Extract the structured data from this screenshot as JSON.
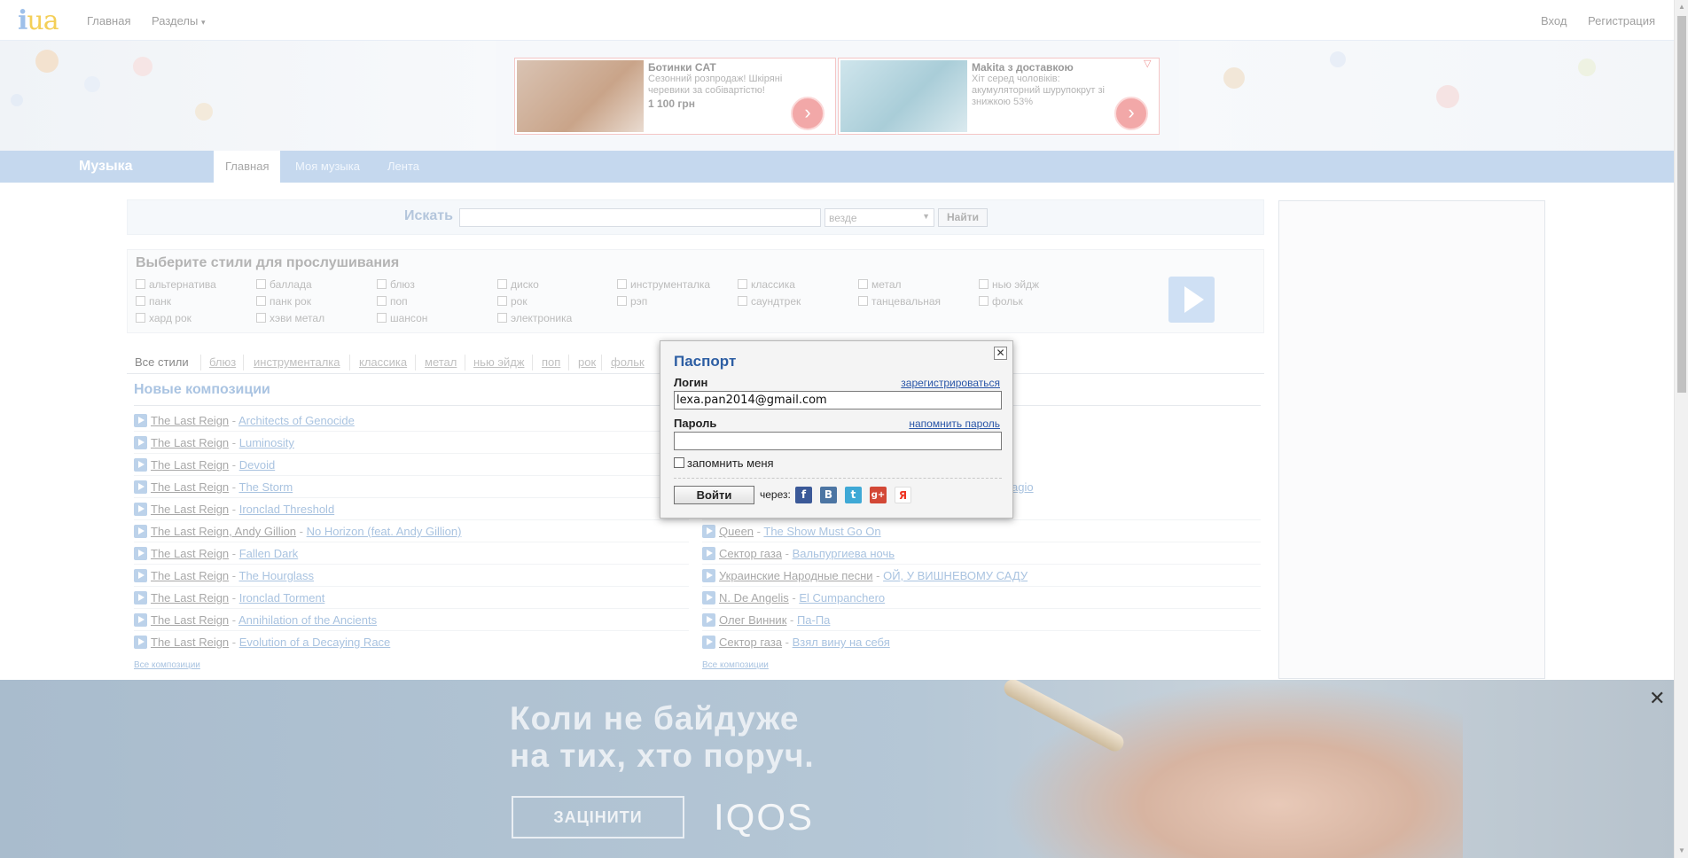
{
  "topbar": {
    "logo_i": "i",
    "logo_ua": "ua",
    "nav_home": "Главная",
    "nav_sections": "Разделы",
    "nav_sections_arrow": "▾",
    "login": "Вход",
    "register": "Регистрация"
  },
  "ads": [
    {
      "title": "Ботинки CAT",
      "text": "Сезонний розпродаж! Шкіряні черевики за собівартістю!",
      "price": "1 100 грн"
    },
    {
      "title": "Makita з доставкою",
      "text": "Хіт серед чоловіків: акумуляторний шурупокрут зі знижкою 53%",
      "price": ""
    }
  ],
  "music": {
    "title": "Музыка",
    "tabs": [
      "Главная",
      "Моя музыка",
      "Лента"
    ]
  },
  "search": {
    "label": "Искать",
    "value": "",
    "scope": "везде",
    "button": "Найти"
  },
  "styles": {
    "heading": "Выберите стили для прослушивания",
    "items": [
      "альтернатива",
      "баллада",
      "блюз",
      "диско",
      "инструменталка",
      "классика",
      "метал",
      "нью эйдж",
      "панк",
      "панк рок",
      "поп",
      "рок",
      "рэп",
      "саундтрек",
      "танцевальная",
      "фольк",
      "хард рок",
      "хэви метал",
      "шансон",
      "электроника"
    ]
  },
  "filters": [
    "Все стили",
    "блюз",
    "инструменталка",
    "классика",
    "метал",
    "нью эйдж",
    "поп",
    "рок",
    "фольк"
  ],
  "new_tracks": {
    "heading": "Новые композиции",
    "left": [
      {
        "artist": "The Last Reign",
        "song": "Architects of Genocide"
      },
      {
        "artist": "The Last Reign",
        "song": "Luminosity"
      },
      {
        "artist": "The Last Reign",
        "song": "Devoid"
      },
      {
        "artist": "The Last Reign",
        "song": "The Storm"
      },
      {
        "artist": "The Last Reign",
        "song": "Ironclad Threshold"
      },
      {
        "artist": "The Last Reign, Andy Gillion",
        "song": "No Horizon (feat. Andy Gillion)"
      },
      {
        "artist": "The Last Reign",
        "song": "Fallen Dark"
      },
      {
        "artist": "The Last Reign",
        "song": "The Hourglass"
      },
      {
        "artist": "The Last Reign",
        "song": "Ironclad Torment"
      },
      {
        "artist": "The Last Reign",
        "song": "Annihilation of the Ancients"
      },
      {
        "artist": "The Last Reign",
        "song": "Evolution of a Decaying Race"
      }
    ],
    "right_partial_4": "agio",
    "right": [
      {
        "artist": "Queen",
        "song": "The Show Must Go On"
      },
      {
        "artist": "Сектор газа",
        "song": "Вальпургиева ночь"
      },
      {
        "artist": "Украинские Народные песни",
        "song": "ОЙ, У ВИШНЕВОМУ САДУ"
      },
      {
        "artist": "N. De Angelis",
        "song": "El Cumpanchero"
      },
      {
        "artist": "Олег Винник",
        "song": "Па-Па"
      },
      {
        "artist": "Сектор газа",
        "song": "Взял вину на себя"
      }
    ],
    "all_left": "Все композиции",
    "all_right": "Все композиции",
    "dash": " - "
  },
  "popup": {
    "title": "Паспорт",
    "close": "✕",
    "login_label": "Логин",
    "register_link": "зарегистрироваться",
    "login_value": "lexa.pan2014@gmail.com",
    "password_label": "Пароль",
    "remind_link": "напомнить пароль",
    "password_value": "",
    "remember": "запомнить меня",
    "submit": "Войти",
    "via": "через:",
    "social": [
      "f",
      "B",
      "t",
      "g+",
      "Я"
    ],
    "social_colors": [
      "#3b5998",
      "#4c75a3",
      "#3fa9d6",
      "#d34836",
      "#ffffff"
    ]
  },
  "bottom_ad": {
    "line1": "Коли не байдуже",
    "line2": "на тих, хто поруч.",
    "cta": "ЗАЦІНИТИ",
    "brand": "IQOS",
    "close": "✕"
  }
}
